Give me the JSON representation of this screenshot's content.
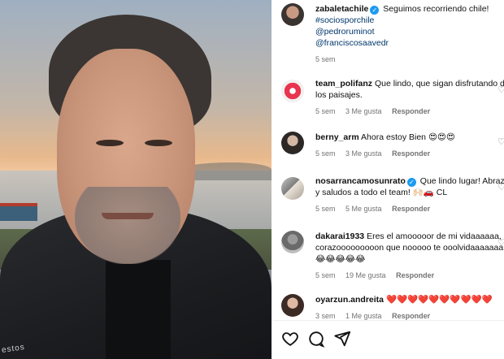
{
  "media": {
    "watermark": "estos"
  },
  "caption": {
    "username": "zabaletachile",
    "text": "Seguimos recorriendo chile!",
    "hashtag": "#sociosporchile",
    "mention1": "@pedroruminot",
    "mention2": "@franciscosaavedr",
    "time": "5 sem"
  },
  "comments": [
    {
      "username": "team_polifanz",
      "text": "Que lindo, que sigan disfrutando de los paisajes.",
      "time": "5 sem",
      "likes": "3 Me gusta",
      "reply": "Responder",
      "verified": false
    },
    {
      "username": "berny_arm",
      "text": "Ahora estoy Bien",
      "emoji": "😍😍😍",
      "time": "5 sem",
      "likes": "3 Me gusta",
      "reply": "Responder",
      "verified": false
    },
    {
      "username": "nosarrancamosunrato",
      "text": "Que lindo lugar! Abrazos y saludos a todo el team!",
      "emoji": "🙌🏻🚗 CL",
      "time": "5 sem",
      "likes": "5 Me gusta",
      "reply": "Responder",
      "verified": true
    },
    {
      "username": "dakarai1933",
      "text": "Eres el amooooor de mi vidaaaaaa, corazooooooooon que nooooo te ooolvidaaaaaaa",
      "emoji": "😂😂😂😂😂",
      "time": "5 sem",
      "likes": "19 Me gusta",
      "reply": "Responder",
      "verified": false
    },
    {
      "username": "oyarzun.andreita",
      "text": "",
      "emoji": "❤️❤️❤️❤️❤️❤️❤️❤️❤️❤️",
      "time": "3 sem",
      "likes": "1 Me gusta",
      "reply": "Responder",
      "verified": false
    }
  ],
  "icons": {
    "verified": "✓",
    "like": "heart-icon",
    "comment": "comment-icon",
    "share": "share-icon"
  },
  "colors": {
    "link": "#00376b",
    "muted": "#737373",
    "verified": "#1d9bf0"
  }
}
